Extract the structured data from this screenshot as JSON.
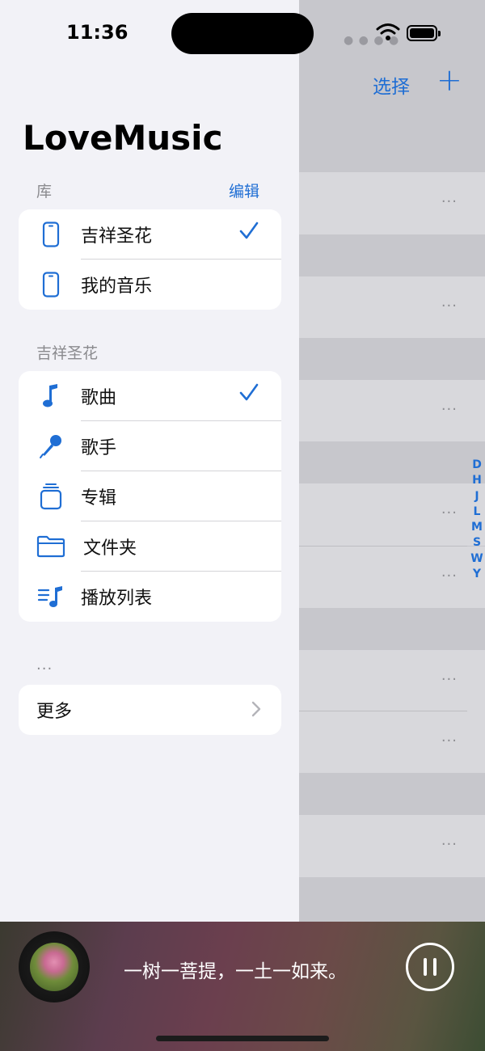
{
  "status": {
    "time": "11:36"
  },
  "background": {
    "select_label": "选择",
    "add_label": "+",
    "row_dots": "···",
    "index_letters": [
      "D",
      "H",
      "J",
      "L",
      "M",
      "S",
      "W",
      "Y"
    ]
  },
  "drawer": {
    "title": "LoveMusic",
    "library": {
      "section_label": "库",
      "edit_label": "编辑",
      "items": [
        {
          "label": "吉祥圣花",
          "icon": "phone-icon",
          "selected": true
        },
        {
          "label": "我的音乐",
          "icon": "phone-icon",
          "selected": false
        }
      ]
    },
    "category": {
      "section_label": "吉祥圣花",
      "items": [
        {
          "label": "歌曲",
          "icon": "music-note-icon",
          "selected": true
        },
        {
          "label": "歌手",
          "icon": "microphone-icon",
          "selected": false
        },
        {
          "label": "专辑",
          "icon": "album-stack-icon",
          "selected": false
        },
        {
          "label": "文件夹",
          "icon": "folder-icon",
          "selected": false
        },
        {
          "label": "播放列表",
          "icon": "playlist-icon",
          "selected": false
        }
      ]
    },
    "more": {
      "section_label": "...",
      "label": "更多"
    }
  },
  "player": {
    "lyric": "一树一菩提，一土一如来。"
  },
  "colors": {
    "accent": "#1f6ed4",
    "drawer_bg": "#f2f2f7",
    "scrim": "#c7c7cc"
  }
}
